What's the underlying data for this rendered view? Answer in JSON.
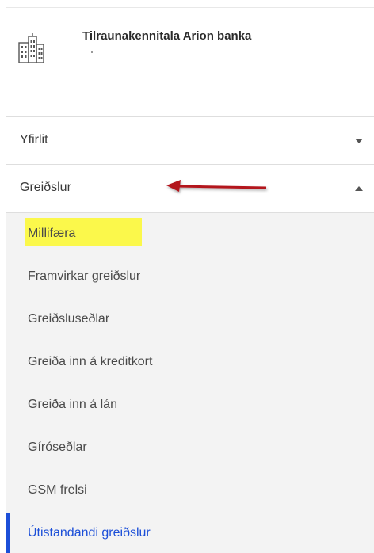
{
  "company": {
    "name": "Tilraunakennitala Arion banka",
    "icon": "building-icon"
  },
  "nav": {
    "overview": {
      "label": "Yfirlit",
      "icon": "chevron-down-icon"
    },
    "payments": {
      "label": "Greiðslur",
      "icon": "chevron-up-icon"
    }
  },
  "submenu": {
    "items": [
      {
        "label": "Millifæra"
      },
      {
        "label": "Framvirkar greiðslur"
      },
      {
        "label": "Greiðsluseðlar"
      },
      {
        "label": "Greiða inn á kreditkort"
      },
      {
        "label": "Greiða inn á lán"
      },
      {
        "label": "Gíróseðlar"
      },
      {
        "label": "GSM frelsi"
      },
      {
        "label": "Útistandandi greiðslur"
      }
    ]
  },
  "colors": {
    "accent": "#1c4fd8",
    "highlight": "#fbf84b",
    "annotation_arrow": "#b3121c"
  }
}
